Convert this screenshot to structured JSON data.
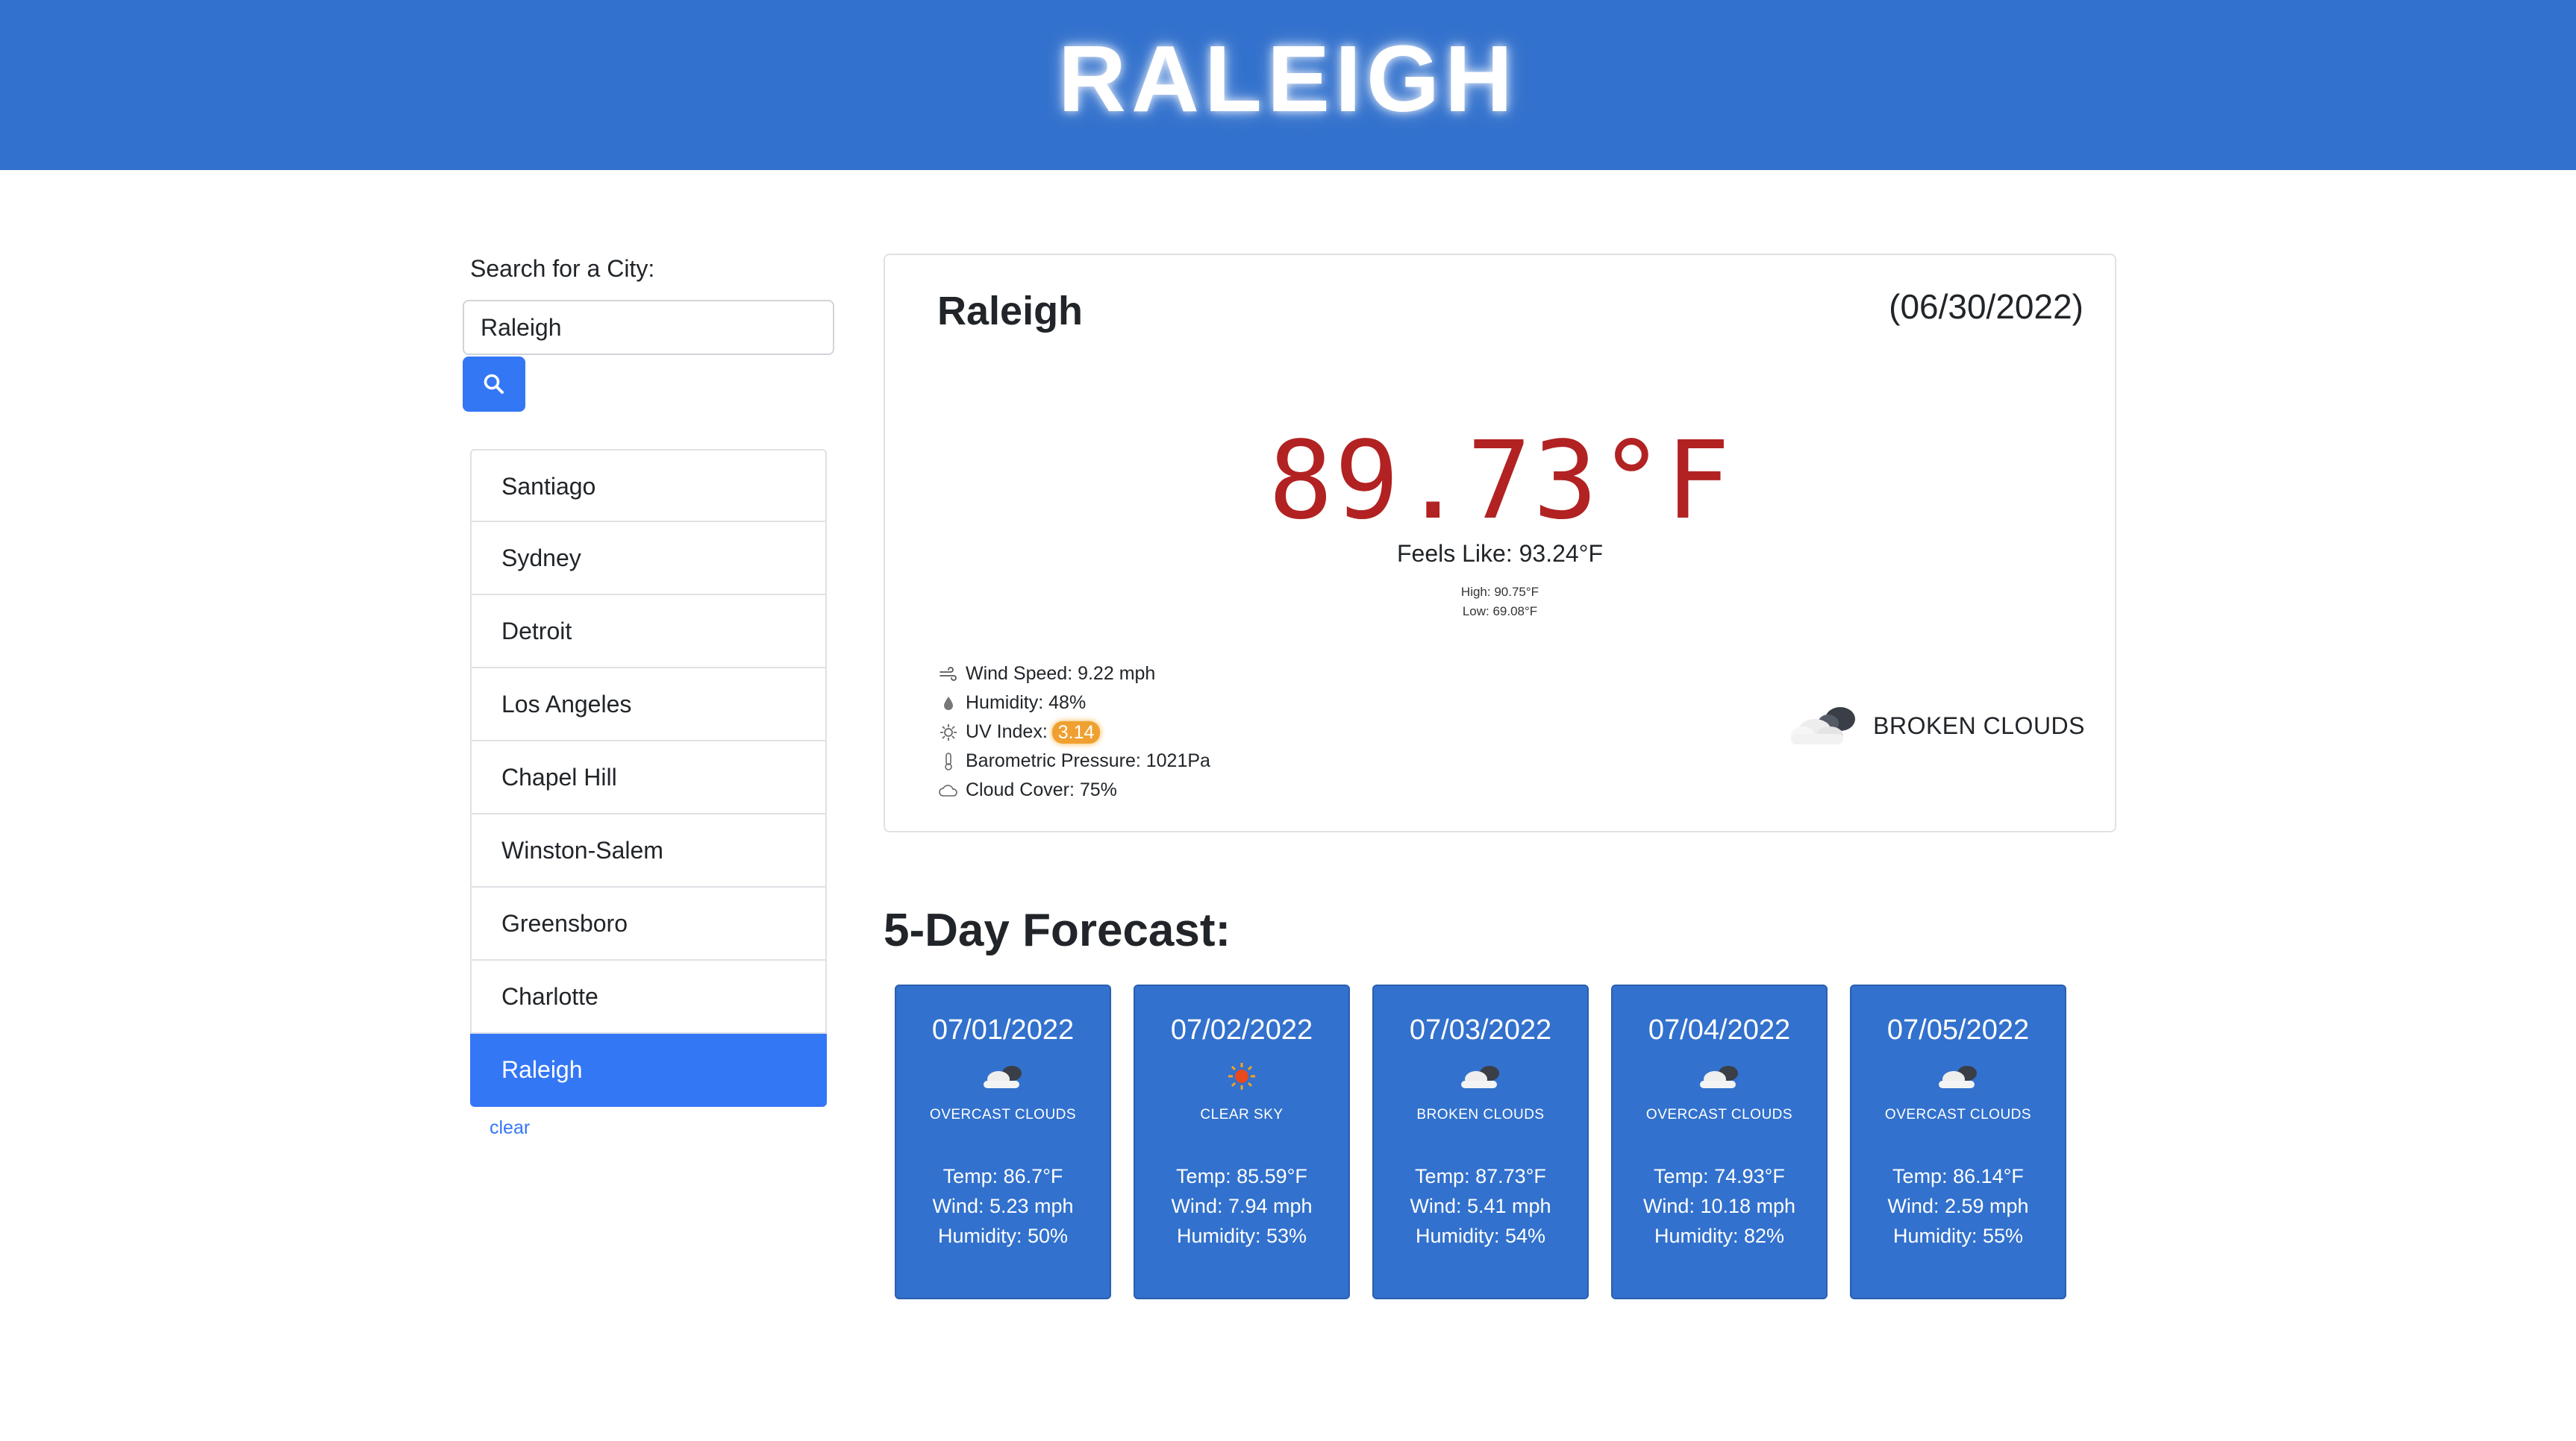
{
  "header": {
    "title": "RALEIGH"
  },
  "search": {
    "label": "Search for a City:",
    "value": "Raleigh",
    "button_icon": "search-icon"
  },
  "history": {
    "cities": [
      "Santiago",
      "Sydney",
      "Detroit",
      "Los Angeles",
      "Chapel Hill",
      "Winston-Salem",
      "Greensboro",
      "Charlotte",
      "Raleigh"
    ],
    "active": "Raleigh",
    "clear_label": "clear"
  },
  "current": {
    "city": "Raleigh",
    "date": "(06/30/2022)",
    "temp": "89.73°F",
    "feels_like": "Feels Like: 93.24°F",
    "high": "High: 90.75°F",
    "low": "Low: 69.08°F",
    "details": {
      "wind": "Wind Speed: 9.22 mph",
      "humidity": "Humidity: 48%",
      "uv_label": "UV Index:",
      "uv_value": "3.14",
      "pressure": "Barometric Pressure: 1021Pa",
      "cloud": "Cloud Cover: 75%"
    },
    "conditions": "BROKEN CLOUDS",
    "conditions_icon": "broken-clouds-icon"
  },
  "forecast": {
    "title": "5-Day Forecast:",
    "days": [
      {
        "date": "07/01/2022",
        "icon": "overcast-clouds-icon",
        "desc": "OVERCAST CLOUDS",
        "temp": "Temp: 86.7°F",
        "wind": "Wind: 5.23 mph",
        "humidity": "Humidity: 50%"
      },
      {
        "date": "07/02/2022",
        "icon": "clear-sky-icon",
        "desc": "CLEAR SKY",
        "temp": "Temp: 85.59°F",
        "wind": "Wind: 7.94 mph",
        "humidity": "Humidity: 53%"
      },
      {
        "date": "07/03/2022",
        "icon": "broken-clouds-icon",
        "desc": "BROKEN CLOUDS",
        "temp": "Temp: 87.73°F",
        "wind": "Wind: 5.41 mph",
        "humidity": "Humidity: 54%"
      },
      {
        "date": "07/04/2022",
        "icon": "overcast-clouds-icon",
        "desc": "OVERCAST CLOUDS",
        "temp": "Temp: 74.93°F",
        "wind": "Wind: 10.18 mph",
        "humidity": "Humidity: 82%"
      },
      {
        "date": "07/05/2022",
        "icon": "overcast-clouds-icon",
        "desc": "OVERCAST CLOUDS",
        "temp": "Temp: 86.14°F",
        "wind": "Wind: 2.59 mph",
        "humidity": "Humidity: 55%"
      }
    ]
  },
  "colors": {
    "banner": "#3271cd",
    "accent": "#3477f5",
    "temp": "#b22222",
    "uv_badge": "#f0a030"
  }
}
